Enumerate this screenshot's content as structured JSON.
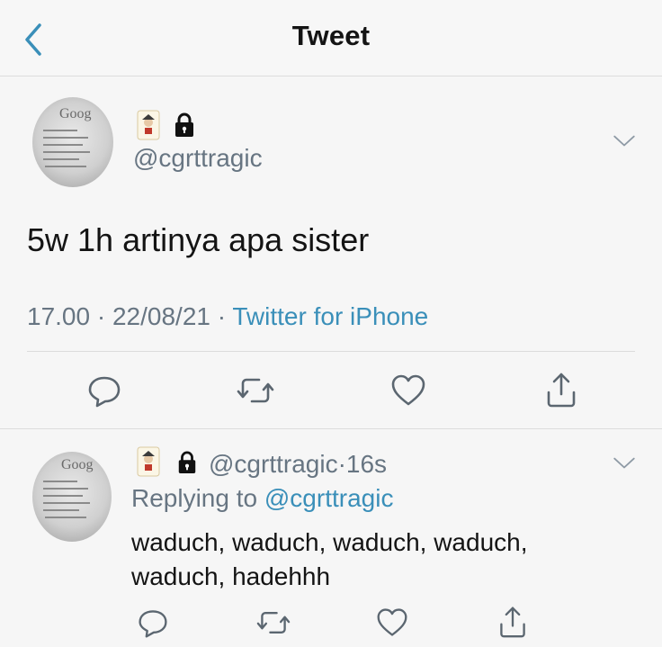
{
  "header": {
    "title": "Tweet"
  },
  "tweet": {
    "handle": "@cgrttragic",
    "text": "5w 1h artinya apa sister",
    "time": "17.00",
    "date": "22/08/21",
    "source": "Twitter for iPhone",
    "separator": "·"
  },
  "reply": {
    "handle": "@cgrttragic",
    "age": "16s",
    "replying_prefix": "Replying to",
    "replying_to": "@cgrttragic",
    "text_line1": "waduch, waduch, waduch, waduch,",
    "text_line2": "waduch, hadehhh"
  },
  "avatar_text": "Goog",
  "icons": {
    "back": "chevron-left-icon",
    "more": "chevron-down-icon",
    "reply": "reply-icon",
    "retweet": "retweet-icon",
    "like": "heart-icon",
    "share": "share-icon",
    "lock": "lock-icon"
  },
  "colors": {
    "accent": "#3a8fb9",
    "muted": "#677582",
    "text": "#141414"
  }
}
